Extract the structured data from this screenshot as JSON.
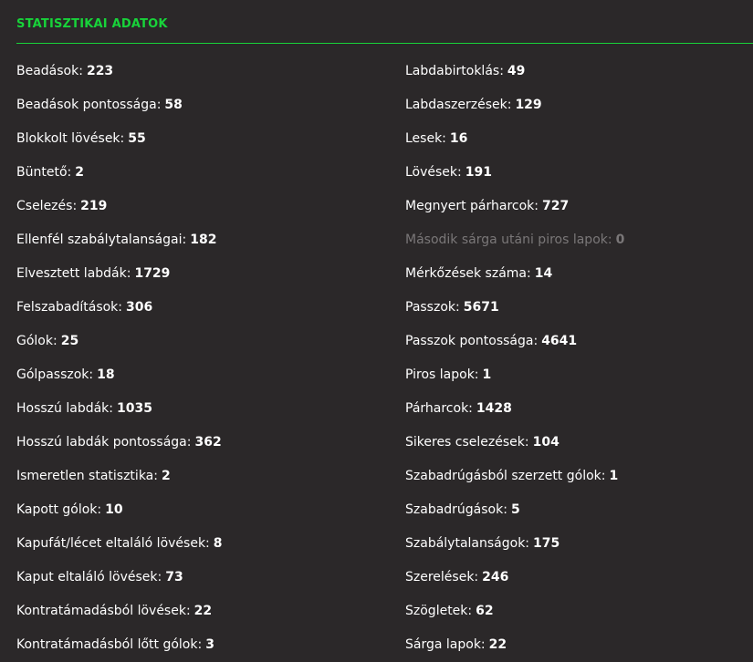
{
  "section": {
    "title": "STATISZTIKAI ADATOK"
  },
  "colors": {
    "accent": "#18d33a",
    "background": "#2b2829",
    "text": "#ffffff",
    "disabled_text": "#7a7778"
  },
  "left_stats": [
    {
      "label": "Beadások:",
      "value": "223"
    },
    {
      "label": "Beadások pontossága:",
      "value": "58"
    },
    {
      "label": "Blokkolt lövések:",
      "value": "55"
    },
    {
      "label": "Büntető:",
      "value": "2"
    },
    {
      "label": "Cselezés:",
      "value": "219"
    },
    {
      "label": "Ellenfél szabálytalanságai:",
      "value": "182"
    },
    {
      "label": "Elvesztett labdák:",
      "value": "1729"
    },
    {
      "label": "Felszabadítások:",
      "value": "306"
    },
    {
      "label": "Gólok:",
      "value": "25"
    },
    {
      "label": "Gólpasszok:",
      "value": "18"
    },
    {
      "label": "Hosszú labdák:",
      "value": "1035"
    },
    {
      "label": "Hosszú labdák pontossága:",
      "value": "362"
    },
    {
      "label": "Ismeretlen statisztika:",
      "value": "2"
    },
    {
      "label": "Kapott gólok:",
      "value": "10"
    },
    {
      "label": "Kapufát/lécet eltaláló lövések:",
      "value": "8"
    },
    {
      "label": "Kaput eltaláló lövések:",
      "value": "73"
    },
    {
      "label": "Kontratámadásból lövések:",
      "value": "22"
    },
    {
      "label": "Kontratámadásból lőtt gólok:",
      "value": "3"
    }
  ],
  "right_stats": [
    {
      "label": "Labdabirtoklás:",
      "value": "49"
    },
    {
      "label": "Labdaszerzések:",
      "value": "129"
    },
    {
      "label": "Lesek:",
      "value": "16"
    },
    {
      "label": "Lövések:",
      "value": "191"
    },
    {
      "label": "Megnyert párharcok:",
      "value": "727"
    },
    {
      "label": "Második sárga utáni piros lapok:",
      "value": "0",
      "disabled": true
    },
    {
      "label": "Mérkőzések száma:",
      "value": "14"
    },
    {
      "label": "Passzok:",
      "value": "5671"
    },
    {
      "label": "Passzok pontossága:",
      "value": "4641"
    },
    {
      "label": "Piros lapok:",
      "value": "1"
    },
    {
      "label": "Párharcok:",
      "value": "1428"
    },
    {
      "label": "Sikeres cselezések:",
      "value": "104"
    },
    {
      "label": "Szabadrúgásból szerzett gólok:",
      "value": "1"
    },
    {
      "label": "Szabadrúgások:",
      "value": "5"
    },
    {
      "label": "Szabálytalanságok:",
      "value": "175"
    },
    {
      "label": "Szerelések:",
      "value": "246"
    },
    {
      "label": "Szögletek:",
      "value": "62"
    },
    {
      "label": "Sárga lapok:",
      "value": "22"
    }
  ]
}
